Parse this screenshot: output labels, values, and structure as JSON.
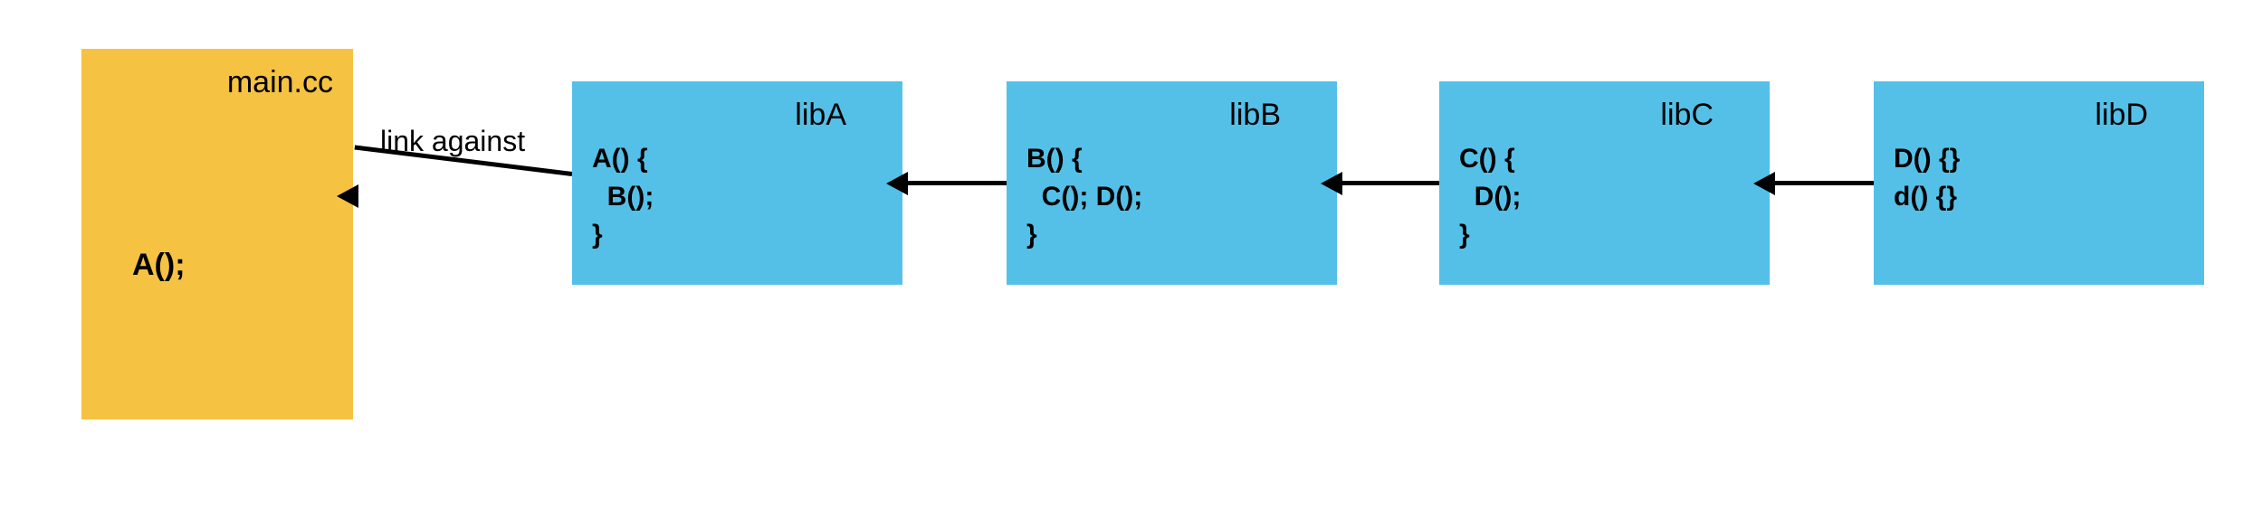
{
  "main": {
    "title": "main.cc",
    "call": "A();"
  },
  "arrow_label": "link against",
  "libs": {
    "A": {
      "name": "libA",
      "code": "A() {\n  B();\n}"
    },
    "B": {
      "name": "libB",
      "code": "B() {\n  C(); D();\n}"
    },
    "C": {
      "name": "libC",
      "code": "C() {\n  D();\n}"
    },
    "D": {
      "name": "libD",
      "code": "D() {}\nd() {}"
    }
  }
}
